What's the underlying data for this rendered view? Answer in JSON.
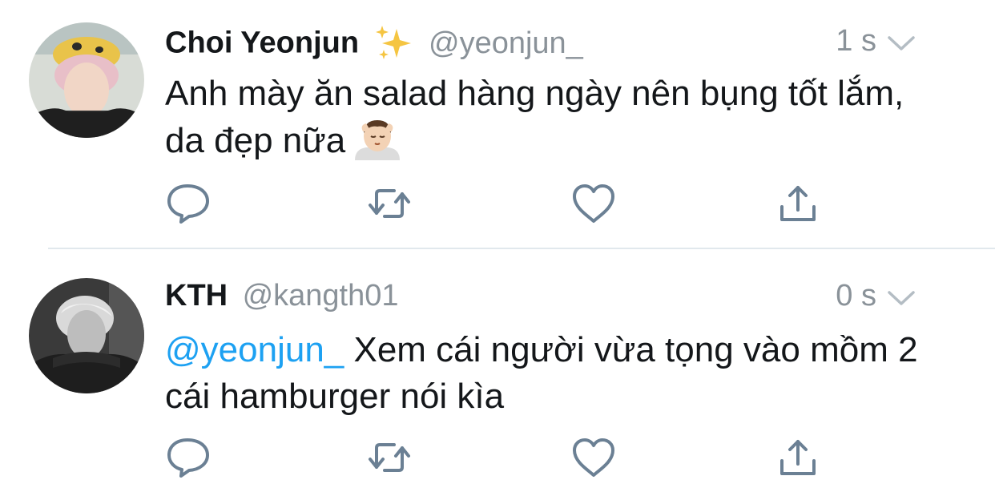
{
  "tweets": [
    {
      "name": "Choi Yeonjun",
      "name_emoji": "sparkles-icon",
      "handle": "@yeonjun_",
      "time": "1 s",
      "text": "Anh mày ăn salad hàng ngày nên bụng tốt lắm, da đẹp nữa",
      "text_emoji": "face-massage-icon"
    },
    {
      "name": "KTH",
      "handle": "@kangth01",
      "time": "0 s",
      "mention": "@yeonjun_",
      "text": " Xem cái người vừa tọng vào mồm 2 cái hamburger nói kìa"
    }
  ],
  "actions": [
    "reply-icon",
    "retweet-icon",
    "like-icon",
    "share-icon"
  ],
  "colors": {
    "text": "#14171a",
    "secondary": "#8a9299",
    "link": "#1da1f2",
    "icon": "#6b8094",
    "divider": "#e1e8ed"
  }
}
